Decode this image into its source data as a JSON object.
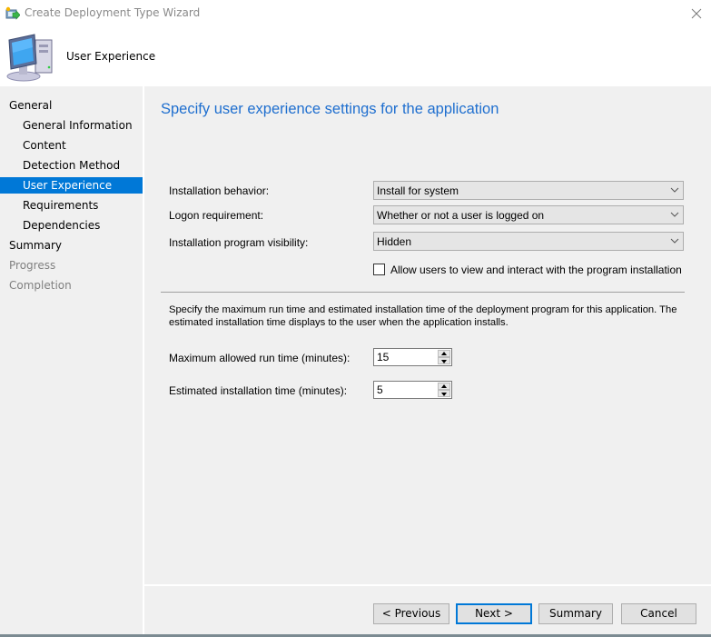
{
  "window": {
    "title": "Create Deployment Type Wizard",
    "app_icon": "wizard-app-icon",
    "close_icon": "close-icon"
  },
  "header": {
    "title": "User Experience",
    "icon": "computer-icon"
  },
  "sidebar": {
    "items": [
      {
        "label": "General",
        "level": 1,
        "state": "normal"
      },
      {
        "label": "General Information",
        "level": 2,
        "state": "normal"
      },
      {
        "label": "Content",
        "level": 2,
        "state": "normal"
      },
      {
        "label": "Detection Method",
        "level": 2,
        "state": "normal"
      },
      {
        "label": "User Experience",
        "level": 2,
        "state": "active"
      },
      {
        "label": "Requirements",
        "level": 2,
        "state": "normal"
      },
      {
        "label": "Dependencies",
        "level": 2,
        "state": "normal"
      },
      {
        "label": "Summary",
        "level": 1,
        "state": "normal"
      },
      {
        "label": "Progress",
        "level": 1,
        "state": "disabled"
      },
      {
        "label": "Completion",
        "level": 1,
        "state": "disabled"
      }
    ]
  },
  "main": {
    "heading": "Specify user experience settings for the application",
    "fields": {
      "installation_behavior": {
        "label": "Installation behavior:",
        "value": "Install for system"
      },
      "logon_requirement": {
        "label": "Logon requirement:",
        "value": "Whether or not a user is logged on"
      },
      "program_visibility": {
        "label": "Installation program visibility:",
        "value": "Hidden"
      }
    },
    "allow_interact": {
      "label": "Allow users to view and interact with the program installation",
      "checked": false
    },
    "description": "Specify the maximum run time and estimated installation time of the deployment program for this application. The estimated installation time displays to the user when the application installs.",
    "max_run_time": {
      "label": "Maximum allowed run time (minutes):",
      "value": "15"
    },
    "estimated_time": {
      "label": "Estimated installation time (minutes):",
      "value": "5"
    }
  },
  "footer": {
    "previous_label": "< Previous",
    "next_label": "Next >",
    "summary_label": "Summary",
    "cancel_label": "Cancel"
  },
  "colors": {
    "accent": "#0078d7",
    "heading": "#1f6fcf",
    "panel_bg": "#f0f0f0",
    "disabled_text": "#808080"
  }
}
